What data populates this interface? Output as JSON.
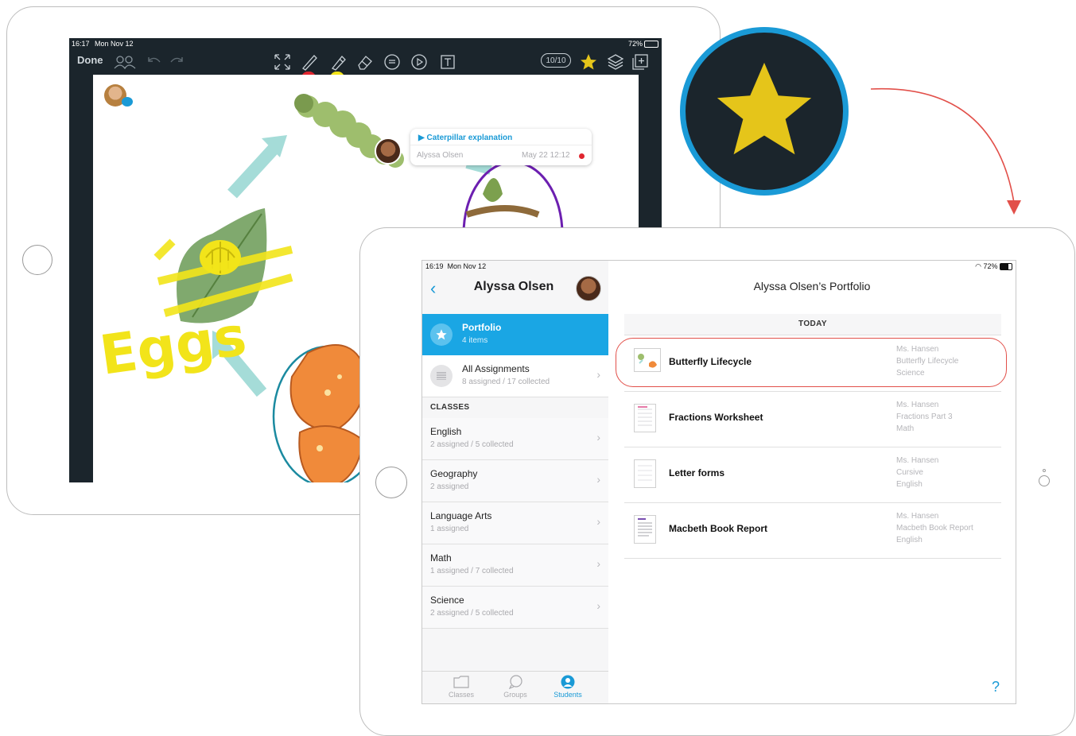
{
  "back_ipad": {
    "status_time": "16:17",
    "status_date": "Mon Nov 12",
    "status_battery": "72%",
    "done_label": "Done",
    "page_count": "10/10",
    "annotation": {
      "title": "Caterpillar explanation",
      "author": "Alyssa Olsen",
      "time": "May 22 12:12"
    },
    "canvas_text": "Eggs"
  },
  "front_ipad": {
    "status_time": "16:19",
    "status_date": "Mon Nov 12",
    "status_battery": "72%",
    "sidebar": {
      "title": "Alyssa Olsen",
      "portfolio": {
        "label": "Portfolio",
        "sub": "4 items"
      },
      "all_assignments": {
        "label": "All Assignments",
        "sub": "8 assigned / 17 collected"
      },
      "classes_header": "CLASSES",
      "classes": [
        {
          "name": "English",
          "sub": "2 assigned / 5 collected"
        },
        {
          "name": "Geography",
          "sub": "2 assigned"
        },
        {
          "name": "Language Arts",
          "sub": "1 assigned"
        },
        {
          "name": "Math",
          "sub": "1 assigned / 7 collected"
        },
        {
          "name": "Science",
          "sub": "2 assigned / 5 collected"
        }
      ],
      "tabs": [
        {
          "label": "Classes",
          "icon": "folder-icon"
        },
        {
          "label": "Groups",
          "icon": "chat-bubbles-icon"
        },
        {
          "label": "Students",
          "icon": "person-icon"
        }
      ]
    },
    "main": {
      "title": "Alyssa Olsen’s Portfolio",
      "section_header": "TODAY",
      "items": [
        {
          "title": "Butterfly Lifecycle",
          "teacher": "Ms. Hansen",
          "assignment": "Butterfly Lifecycle",
          "subject": "Science"
        },
        {
          "title": "Fractions Worksheet",
          "teacher": "Ms. Hansen",
          "assignment": "Fractions Part 3",
          "subject": "Math"
        },
        {
          "title": "Letter forms",
          "teacher": "Ms. Hansen",
          "assignment": "Cursive",
          "subject": "English"
        },
        {
          "title": "Macbeth Book Report",
          "teacher": "Ms. Hansen",
          "assignment": "Macbeth Book Report",
          "subject": "English"
        }
      ],
      "help_label": "?"
    }
  },
  "colors": {
    "accent_blue": "#1aa6e4",
    "dark_toolbar": "#1b252c",
    "star_yellow": "#e5c51a",
    "highlight_red": "#e2504a"
  }
}
